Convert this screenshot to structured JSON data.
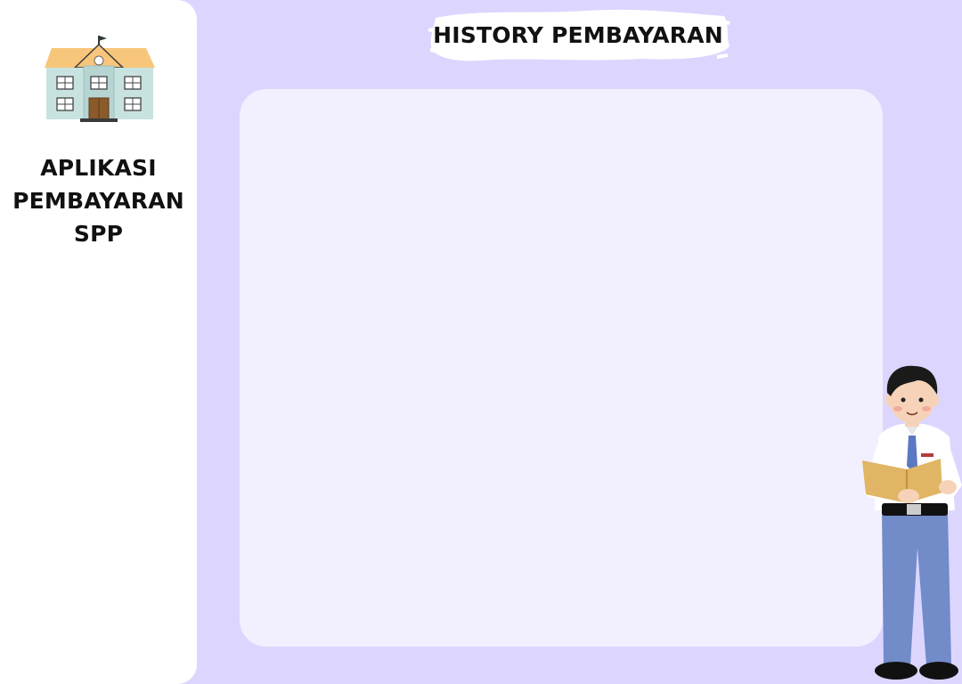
{
  "sidebar": {
    "app_title_lines": [
      "APLIKASI",
      "PEMBAYARAN",
      "SPP"
    ],
    "logo_icon": "school-building-icon"
  },
  "header": {
    "title": "HISTORY PEMBAYARAN"
  },
  "main": {
    "history_panel": {
      "items": []
    }
  },
  "decorations": {
    "student_icon": "student-reading-book-icon"
  },
  "colors": {
    "background": "#dcd6ff",
    "sidebar": "#ffffff",
    "panel": "#f2f0fe",
    "title_text": "#111111"
  }
}
